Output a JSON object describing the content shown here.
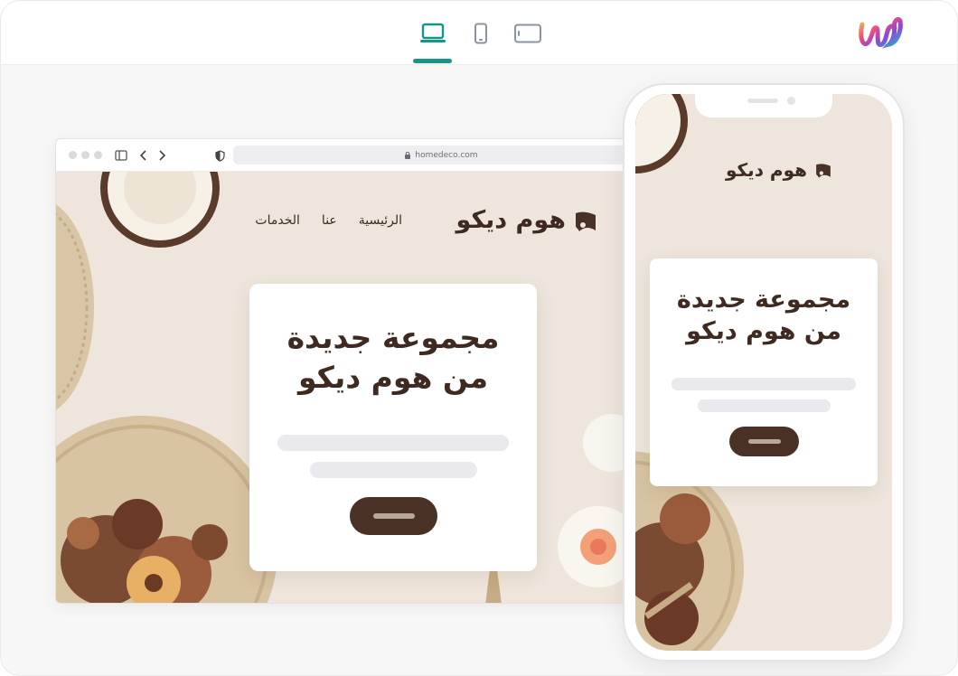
{
  "toolbar": {
    "devices": [
      {
        "name": "desktop",
        "active": true
      },
      {
        "name": "mobile",
        "active": false
      },
      {
        "name": "tablet",
        "active": false
      }
    ],
    "accent_color": "#16958a"
  },
  "browser": {
    "url": "homedeco.com"
  },
  "site": {
    "brand": "هوم ديكو",
    "nav": [
      "الرئيسية",
      "عنا",
      "الخدمات"
    ],
    "hero_title_line1": "مجموعة جديدة",
    "hero_title_line2": "من هوم ديكو",
    "background_color": "#eee6dc",
    "text_color": "#3e2a20",
    "button_color": "#4a3126"
  },
  "mobile": {
    "brand": "هوم ديكو",
    "hero_title_line1": "مجموعة جديدة",
    "hero_title_line2": "من هوم ديكو"
  }
}
